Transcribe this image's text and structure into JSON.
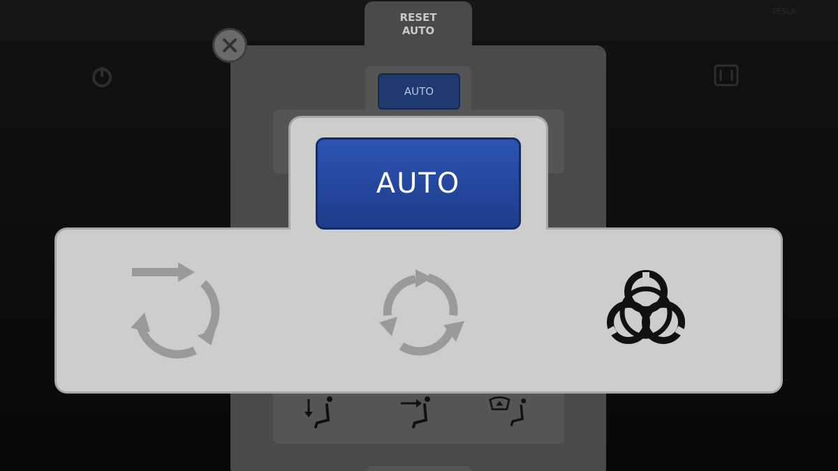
{
  "background": {
    "top_right_text": "TESLA"
  },
  "back_panel": {
    "reset_label": "RESET\nAUTO",
    "auto_label": "AUTO",
    "seat_icons": [
      "feet-vent-icon",
      "face-vent-icon",
      "defrost-vent-icon"
    ]
  },
  "zoom_panel": {
    "auto_label": "AUTO",
    "modes": [
      {
        "name": "fresh-air-icon"
      },
      {
        "name": "recirculate-icon"
      },
      {
        "name": "biohazard-icon"
      }
    ]
  },
  "colors": {
    "auto_button": "#2d54b3",
    "panel_light": "#cdcdcb",
    "icon_gray": "#9a9a9a",
    "icon_black": "#111111"
  }
}
